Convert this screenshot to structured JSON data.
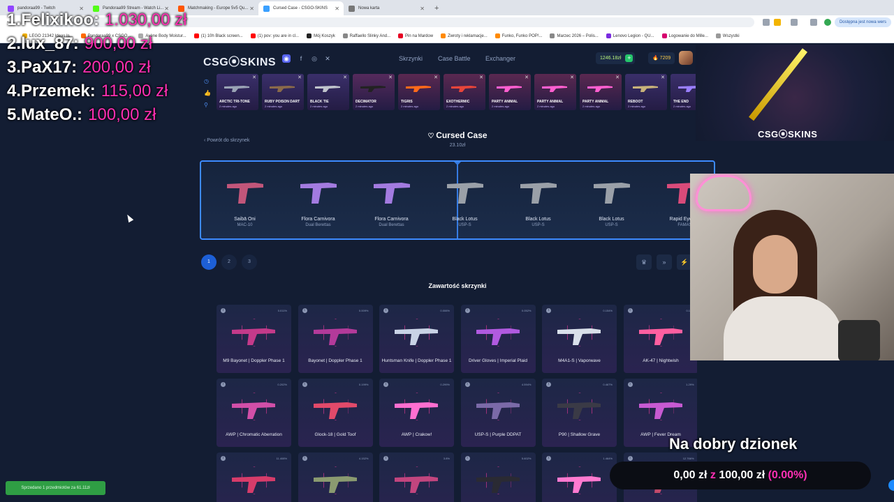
{
  "browser": {
    "tabs": [
      {
        "label": "pandoraa99 - Twitch",
        "color": "#9146ff"
      },
      {
        "label": "Pandoraa99 Stream - Watch Li...",
        "color": "#53fc18"
      },
      {
        "label": "Matchmaking - Europe 5v5 Qu...",
        "color": "#ff5500"
      },
      {
        "label": "Cursed Case - CSGO-SKINS",
        "color": "#3aa0ff"
      },
      {
        "label": "Nowa karta",
        "color": "#777777"
      }
    ],
    "update_label": "Dostępna jest nowa wers",
    "bookmarks": [
      {
        "label": "LEGO 21342 Ideas Is...",
        "color": "#f0b000"
      },
      {
        "label": "Pandoraa99 x CSGO...",
        "color": "#ff6a00"
      },
      {
        "label": "Avène Body Moistur...",
        "color": "#aaaaaa"
      },
      {
        "label": "(1) 10h Black screen...",
        "color": "#ff0000"
      },
      {
        "label": "(1) pov: you are in cl...",
        "color": "#ff0000"
      },
      {
        "label": "Mój Koszyk",
        "color": "#222222"
      },
      {
        "label": "Raffaello Slinky And...",
        "color": "#888888"
      },
      {
        "label": "Pin na Mardow",
        "color": "#e60023"
      },
      {
        "label": "Zwroty i reklamacje...",
        "color": "#ff8a00"
      },
      {
        "label": "Funko, Funko POP!...",
        "color": "#ff8a00"
      },
      {
        "label": "Marzec 2026 – Polis...",
        "color": "#888888"
      },
      {
        "label": "Lenovo Legion - QU...",
        "color": "#7a2be0"
      },
      {
        "label": "Logowanie do Mille...",
        "color": "#d6006e"
      },
      {
        "label": "Wszystki",
        "color": "#999999"
      }
    ]
  },
  "leaderboard": [
    {
      "name": "1.Felixikoo:",
      "amount": "1.030,00 zł"
    },
    {
      "name": "2.lux_87:",
      "amount": "900,00 zł"
    },
    {
      "name": "3.PaX17:",
      "amount": "200,00 zł"
    },
    {
      "name": "4.Przemek:",
      "amount": "115,00 zł"
    },
    {
      "name": "5.MateO.:",
      "amount": "100,00 zł"
    }
  ],
  "site": {
    "logo": "CSG⦿SKINS",
    "nav": [
      "Skrzynki",
      "Case Battle",
      "Exchanger"
    ],
    "balance": "1246.18zł",
    "coins": "7209"
  },
  "drops": [
    {
      "name": "ARCTIC TRI-TONE",
      "sub": "2 minutes ago",
      "bg": "#3a2f6a",
      "gun": "#9aa3b5"
    },
    {
      "name": "RUBY POISON DART",
      "sub": "2 minutes ago",
      "bg": "#3a2f6a",
      "gun": "#8a6a4a"
    },
    {
      "name": "BLACK TIE",
      "sub": "2 minutes ago",
      "bg": "#3a2f6a",
      "gun": "#c0c4cc"
    },
    {
      "name": "DECIMATOR",
      "sub": "2 minutes ago",
      "bg": "#552a5c",
      "gun": "#222222"
    },
    {
      "name": "TIGRIS",
      "sub": "2 minutes ago",
      "bg": "#5a2850",
      "gun": "#ff6a1a"
    },
    {
      "name": "EXOTHERMIC",
      "sub": "2 minutes ago",
      "bg": "#5a2850",
      "gun": "#e8453a"
    },
    {
      "name": "PARTY ANIMAL",
      "sub": "2 minutes ago",
      "bg": "#5a2850",
      "gun": "#ff5fd0"
    },
    {
      "name": "PARTY ANIMAL",
      "sub": "2 minutes ago",
      "bg": "#5a2850",
      "gun": "#ff5fd0"
    },
    {
      "name": "PARTY ANIMAL",
      "sub": "2 minutes ago",
      "bg": "#5a2850",
      "gun": "#ff5fd0"
    },
    {
      "name": "REBOOT",
      "sub": "2 minutes ago",
      "bg": "#3a2f6a",
      "gun": "#c8b27a"
    },
    {
      "name": "THE END",
      "sub": "2 minutes ago",
      "bg": "#3a2f6a",
      "gun": "#9a7fff"
    }
  ],
  "promo_logo": "CSG⦿SKINS",
  "case": {
    "back_label": "Powrót do skrzynek",
    "title": "Cursed Case",
    "price": "23.10zł",
    "contents_title": "Zawartość skrzynki",
    "pages": [
      "1",
      "2",
      "3"
    ]
  },
  "roller": [
    {
      "name": "Saibā Oni",
      "weapon": "MAC-10",
      "color": "#c2567a"
    },
    {
      "name": "Flora Carnivora",
      "weapon": "Dual Berettas",
      "color": "#a37be0"
    },
    {
      "name": "Flora Carnivora",
      "weapon": "Dual Berettas",
      "color": "#a37be0"
    },
    {
      "name": "Black Lotus",
      "weapon": "USP-S",
      "color": "#9aa0a8"
    },
    {
      "name": "Black Lotus",
      "weapon": "USP-S",
      "color": "#9aa0a8"
    },
    {
      "name": "Black Lotus",
      "weapon": "USP-S",
      "color": "#9aa0a8"
    },
    {
      "name": "Rapid Eye Mo",
      "weapon": "FAMAS",
      "color": "#d94b7a"
    }
  ],
  "items": [
    {
      "name": "M9 Bayonet | Doppler Phase 1",
      "pct": "0.011%",
      "color": "#c43a8a"
    },
    {
      "name": "Bayonet | Doppler Phase 1",
      "pct": "0.009%",
      "color": "#b33a9a"
    },
    {
      "name": "Huntsman Knife | Doppler Phase 1",
      "pct": "0.006%",
      "color": "#c9d3e6"
    },
    {
      "name": "Driver Gloves | Imperial Plaid",
      "pct": "0.052%",
      "color": "#b15ae0"
    },
    {
      "name": "M4A1-S | Vaporwave",
      "pct": "0.154%",
      "color": "#d9e0ea"
    },
    {
      "name": "AK-47 | Nightwish",
      "pct": "0.11%",
      "color": "#ff5fa0"
    },
    {
      "name": "AWP | Chromatic Aberration",
      "pct": "0.202%",
      "color": "#d24fa8"
    },
    {
      "name": "Glock-18 | Gold Toof",
      "pct": "0.199%",
      "color": "#e24a6a"
    },
    {
      "name": "AWP | Crakow!",
      "pct": "0.299%",
      "color": "#ff6fd0"
    },
    {
      "name": "USP-S | Purple DDPAT",
      "pct": "4.594%",
      "color": "#7b6aa8"
    },
    {
      "name": "P90 | Shallow Grave",
      "pct": "0.467%",
      "color": "#3a3a46"
    },
    {
      "name": "AWP | Fever Dream",
      "pct": "1.29%",
      "color": "#c75ad2"
    },
    {
      "name": "",
      "pct": "11.408%",
      "color": "#d73c6a"
    },
    {
      "name": "",
      "pct": "4.152%",
      "color": "#8a9a70"
    },
    {
      "name": "",
      "pct": "3.8%",
      "color": "#c2457e"
    },
    {
      "name": "",
      "pct": "5.602%",
      "color": "#2a2a33"
    },
    {
      "name": "",
      "pct": "1.464%",
      "color": "#ff7ad0"
    },
    {
      "name": "",
      "pct": "12.766%",
      "color": "#c24a6a"
    }
  ],
  "stream": {
    "goal_title": "Na dobry dzionek",
    "goal_current": "0,00 zł",
    "goal_sep": "z",
    "goal_target": "100,00 zł",
    "goal_pct": "(0.00%)",
    "goal_progress": 0,
    "toast": "Sprzedano 1 przedmiotów za 61.11zł"
  },
  "colors": {
    "accent": "#3d8bff",
    "donation": "#ff2fb3",
    "background": "#131d33"
  }
}
